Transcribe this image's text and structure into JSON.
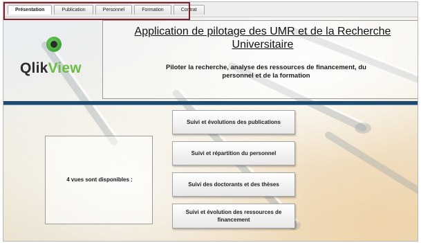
{
  "tabs": [
    {
      "label": "Présentation",
      "active": true
    },
    {
      "label": "Publication",
      "active": false
    },
    {
      "label": "Personnel",
      "active": false
    },
    {
      "label": "Formation",
      "active": false
    },
    {
      "label": "Contrat",
      "active": false
    }
  ],
  "logo": {
    "brand_part1": "Qlik",
    "brand_part2": "View",
    "icon": "qlikview-q-icon"
  },
  "header": {
    "title": "Application de pilotage des UMR et de la Recherche Universitaire",
    "subtitle": "Piloter la recherche, analyse des ressources de financement, du personnel et de la formation"
  },
  "info": {
    "text": "4 vues sont disponibles :"
  },
  "nav_buttons": [
    {
      "label": "Suivi et évolutions des publications"
    },
    {
      "label": "Suivi et répartition du personnel"
    },
    {
      "label": "Suivi des doctorants et des thèses"
    },
    {
      "label": "Suivi et évolution des ressources de financement"
    }
  ],
  "colors": {
    "highlight_border": "#8b1e2a",
    "header_bar": "#1e4a6e",
    "logo_green": "#6cbd45"
  }
}
